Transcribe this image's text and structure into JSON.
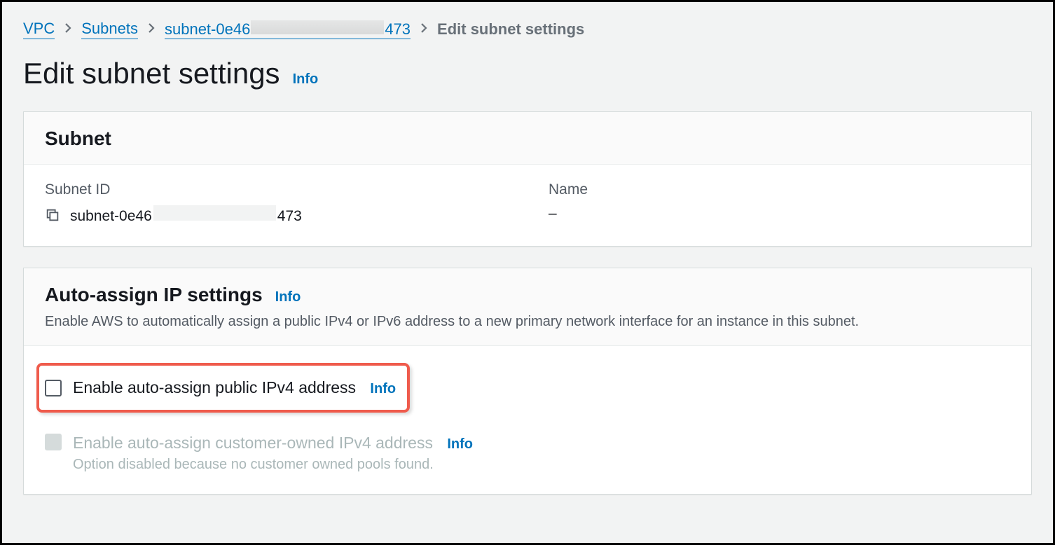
{
  "breadcrumb": {
    "vpc": "VPC",
    "subnets": "Subnets",
    "subnet_prefix": "subnet-0e46",
    "subnet_suffix": "473",
    "current": "Edit subnet settings"
  },
  "page": {
    "title": "Edit subnet settings",
    "info": "Info"
  },
  "subnet_panel": {
    "title": "Subnet",
    "subnet_id_label": "Subnet ID",
    "subnet_id_prefix": "subnet-0e46",
    "subnet_id_suffix": "473",
    "name_label": "Name",
    "name_value": "–"
  },
  "ip_panel": {
    "title": "Auto-assign IP settings",
    "info": "Info",
    "description": "Enable AWS to automatically assign a public IPv4 or IPv6 address to a new primary network interface for an instance in this subnet.",
    "opt1_label": "Enable auto-assign public IPv4 address",
    "opt1_info": "Info",
    "opt2_label": "Enable auto-assign customer-owned IPv4 address",
    "opt2_info": "Info",
    "opt2_note": "Option disabled because no customer owned pools found."
  }
}
